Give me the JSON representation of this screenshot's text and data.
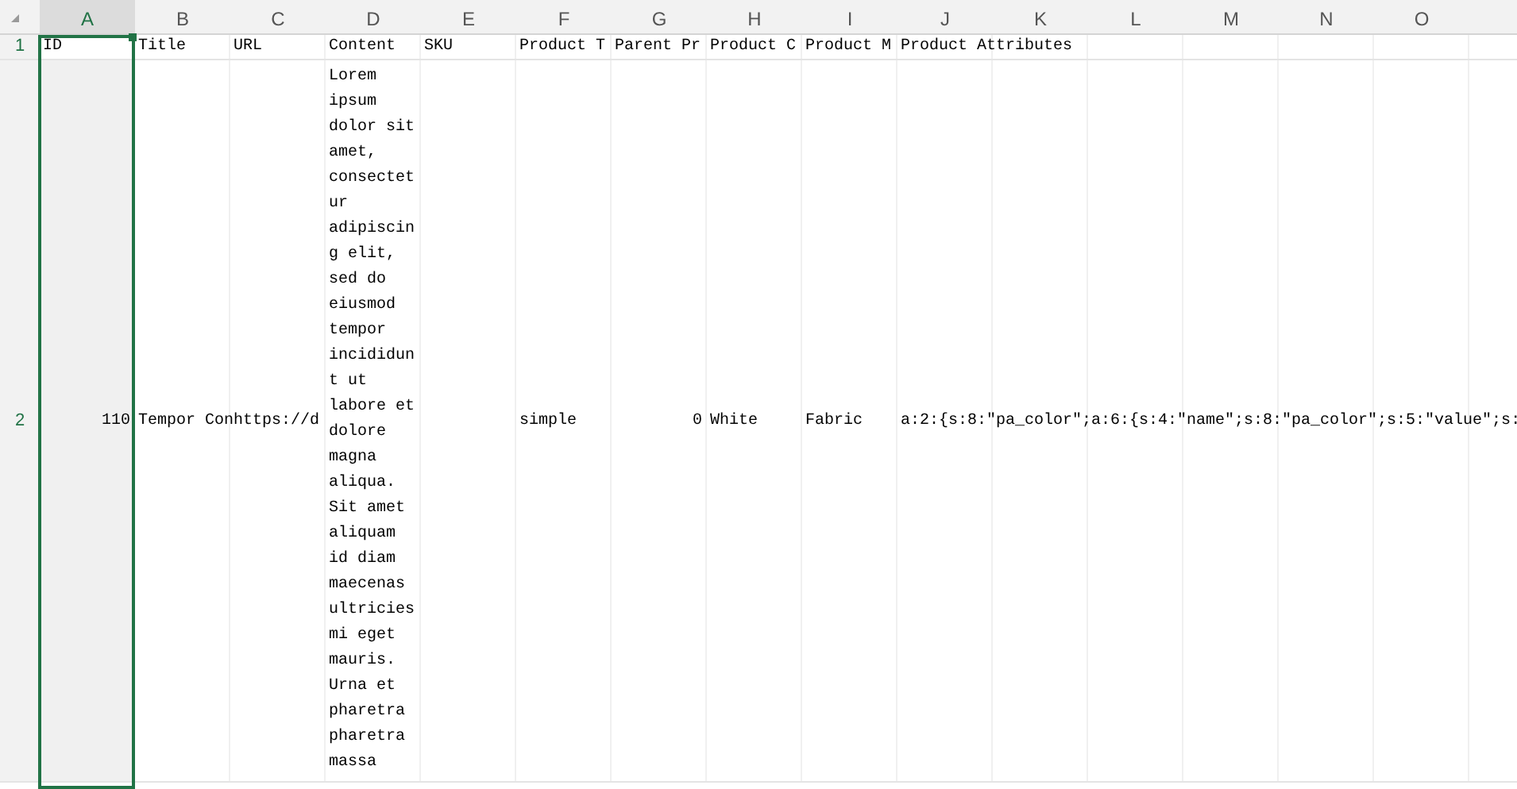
{
  "columns": [
    {
      "label": "A",
      "selected": true
    },
    {
      "label": "B",
      "selected": false
    },
    {
      "label": "C",
      "selected": false
    },
    {
      "label": "D",
      "selected": false
    },
    {
      "label": "E",
      "selected": false
    },
    {
      "label": "F",
      "selected": false
    },
    {
      "label": "G",
      "selected": false
    },
    {
      "label": "H",
      "selected": false
    },
    {
      "label": "I",
      "selected": false
    },
    {
      "label": "J",
      "selected": false
    },
    {
      "label": "K",
      "selected": false
    },
    {
      "label": "L",
      "selected": false
    },
    {
      "label": "M",
      "selected": false
    },
    {
      "label": "N",
      "selected": false
    },
    {
      "label": "O",
      "selected": false
    }
  ],
  "rows": [
    {
      "number": "1",
      "kind": "short",
      "cells": [
        {
          "text": "ID",
          "kind": "text"
        },
        {
          "text": "Title",
          "kind": "text"
        },
        {
          "text": "URL",
          "kind": "text"
        },
        {
          "text": "Content",
          "kind": "text"
        },
        {
          "text": "SKU",
          "kind": "text"
        },
        {
          "text": "Product T",
          "kind": "text"
        },
        {
          "text": "Parent Pr",
          "kind": "text"
        },
        {
          "text": "Product C",
          "kind": "text"
        },
        {
          "text": "Product M",
          "kind": "text"
        },
        {
          "text": "Product Attributes",
          "kind": "text"
        }
      ]
    },
    {
      "number": "2",
      "kind": "tall",
      "cells": [
        {
          "text": "110",
          "kind": "number"
        },
        {
          "text": "Tempor Con",
          "kind": "text"
        },
        {
          "text": "https://d",
          "kind": "text"
        },
        {
          "text": "Lorem ipsum dolor sit amet, consectetur adipiscing elit, sed do eiusmod tempor incididunt ut labore et dolore magna aliqua. Sit amet aliquam id diam maecenas ultricies mi eget mauris. Urna et pharetra pharetra massa",
          "kind": "wrap"
        },
        null,
        {
          "text": "simple",
          "kind": "text"
        },
        {
          "text": "0",
          "kind": "number"
        },
        {
          "text": "White",
          "kind": "text"
        },
        {
          "text": "Fabric",
          "kind": "text"
        },
        {
          "text": "a:2:{s:8:\"pa_color\";a:6:{s:4:\"name\";s:8:\"pa_color\";s:5:\"value\";s:",
          "kind": "text"
        }
      ]
    }
  ]
}
